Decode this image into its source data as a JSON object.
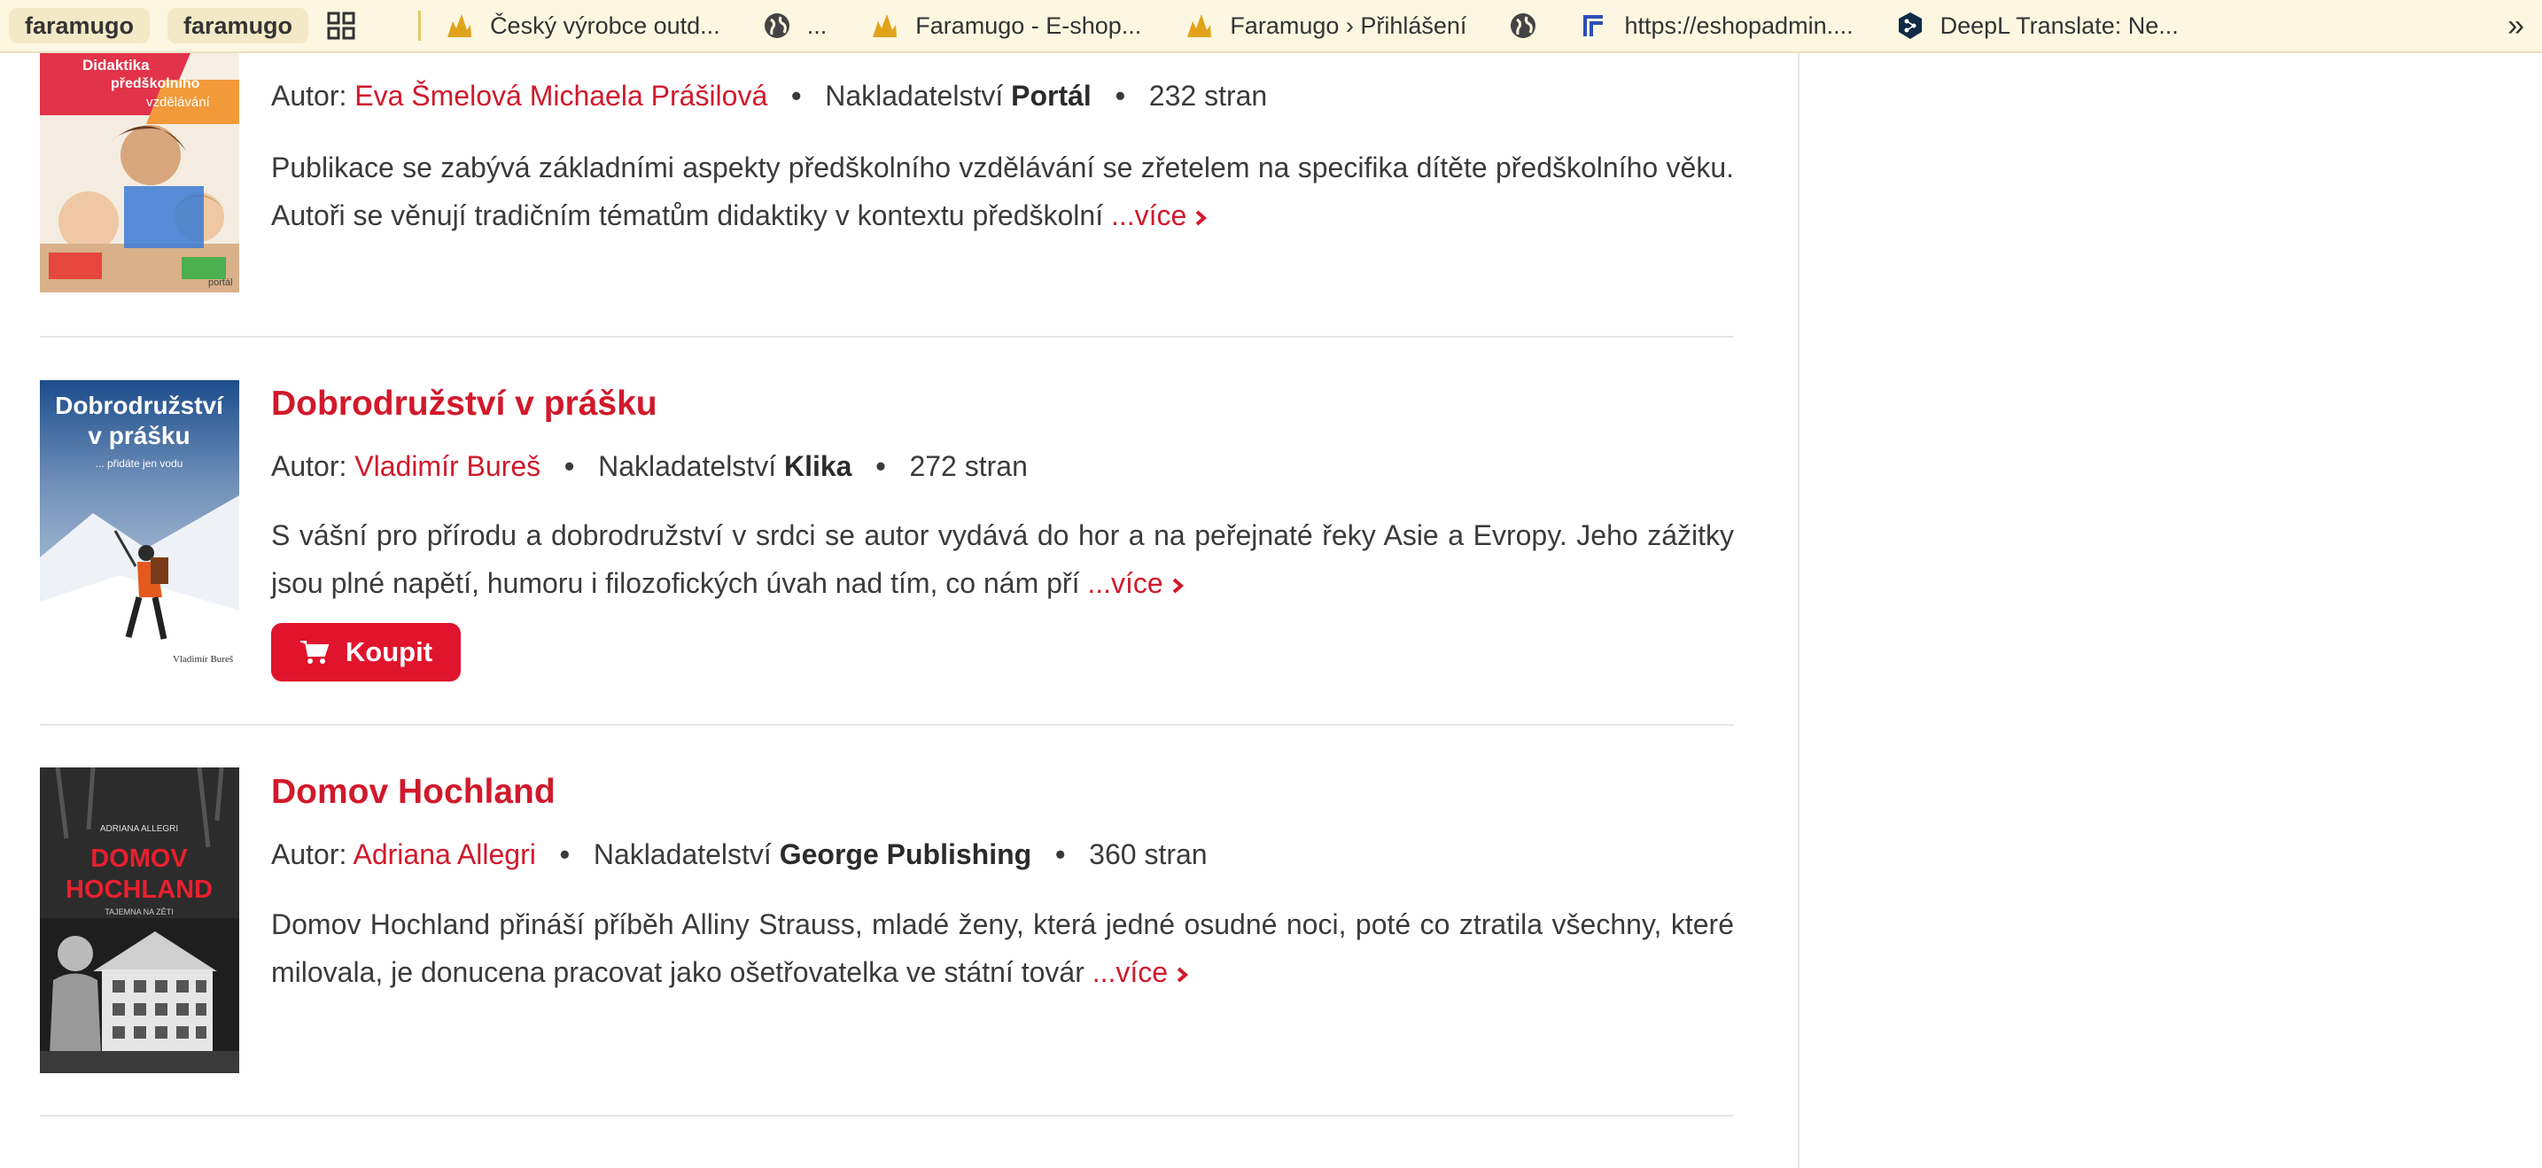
{
  "bookmarks": {
    "chip1": "faramugo",
    "chip2": "faramugo",
    "items": [
      {
        "label": "Český výrobce outd..."
      },
      {
        "label": "..."
      },
      {
        "label": "Faramugo - E-shop..."
      },
      {
        "label": "Faramugo › Přihlášení"
      },
      {
        "label": ""
      },
      {
        "label": "https://eshopadmin...."
      },
      {
        "label": "DeepL Translate: Ne..."
      }
    ],
    "more": "»"
  },
  "labels": {
    "author_prefix": "Autor:",
    "publisher_prefix": "Nakladatelství",
    "more": "...více",
    "buy": "Koupit"
  },
  "books": [
    {
      "cover_text": [
        "Didaktika",
        "předškolního",
        "vzdělávání"
      ],
      "cover_brand": "portál",
      "authors": "Eva Šmelová Michaela Prášilová",
      "publisher": "Portál",
      "pages": "232 stran",
      "description": "Publikace se zabývá základními aspekty předškolního vzdělávání se zřetelem na specifika dítěte předškolního věku. Autoři se věnují tradičním tématům didaktiky v kontextu předškolní"
    },
    {
      "title": "Dobrodružství v prášku",
      "cover_title": [
        "Dobrodružství",
        "v prášku"
      ],
      "cover_subtitle": "... přidáte jen vodu",
      "cover_author": "Vladimír Bureš",
      "authors": "Vladimír Bureš",
      "publisher": "Klika",
      "pages": "272 stran",
      "description": "S vášní pro přírodu a dobrodružství v srdci se autor vydává do hor a na peřejnaté řeky Asie a Evropy. Jeho zážitky jsou plné napětí, humoru i filozofických úvah nad tím, co nám pří"
    },
    {
      "title": "Domov Hochland",
      "cover_author": "ADRIANA ALLEGRI",
      "cover_title": [
        "DOMOV",
        "HOCHLAND"
      ],
      "cover_subtitle": "TAJEMNA NA ZĚTI",
      "authors": "Adriana Allegri",
      "publisher": "George Publishing",
      "pages": "360 stran",
      "description": "Domov Hochland přináší příběh Alliny Strauss, mladé ženy, která jedné osudné noci, poté co ztratila všechny, které milovala, je donucena pracovat jako ošetřovatelka ve státní továr"
    }
  ],
  "colors": {
    "accent": "#d1192b",
    "button": "#e0142c",
    "bookmarks_bg": "#fdf6e1"
  }
}
